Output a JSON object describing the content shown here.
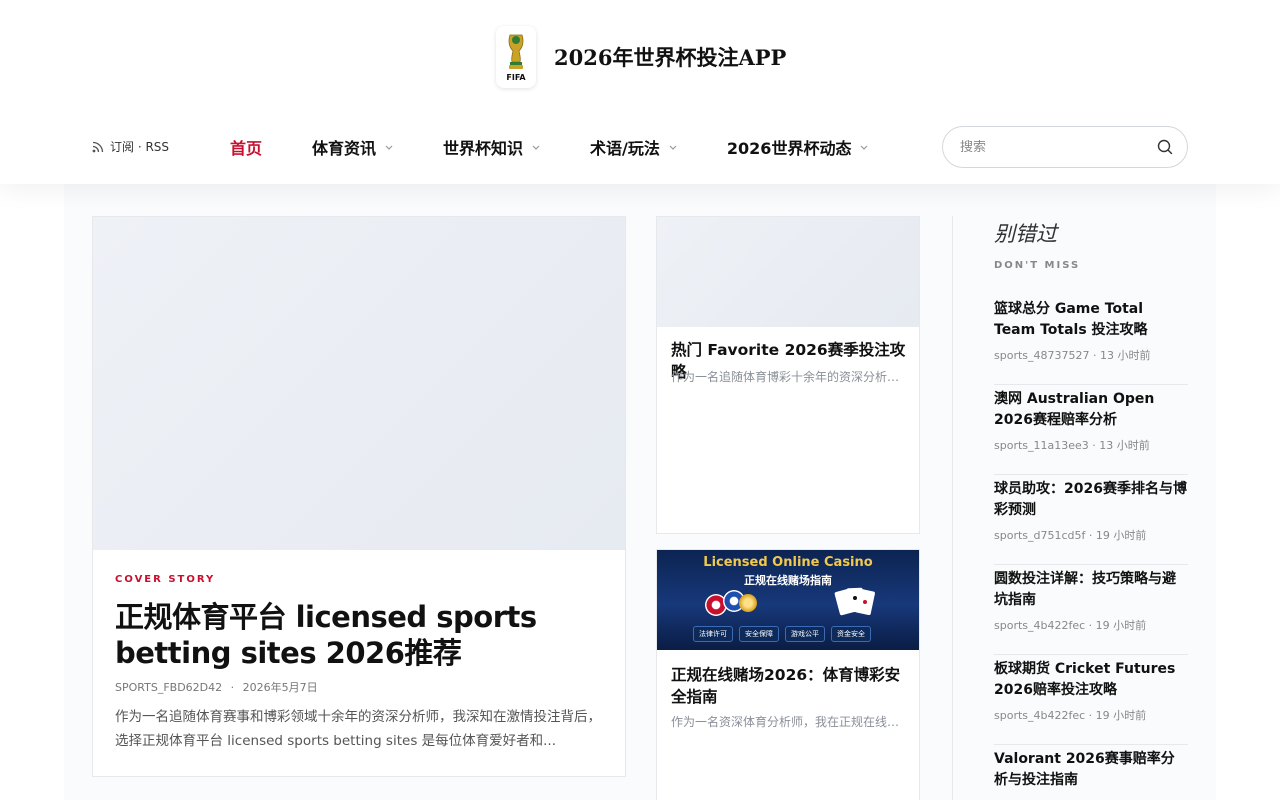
{
  "site": {
    "title": "2026年世界杯投注APP",
    "logo_label": "FIFA"
  },
  "header": {
    "rss_label": "订阅 · RSS",
    "nav": [
      {
        "label": "首页",
        "active": true,
        "has_dropdown": false
      },
      {
        "label": "体育资讯",
        "active": false,
        "has_dropdown": true
      },
      {
        "label": "世界杯知识",
        "active": false,
        "has_dropdown": true
      },
      {
        "label": "术语/玩法",
        "active": false,
        "has_dropdown": true
      },
      {
        "label": "2026世界杯动态",
        "active": false,
        "has_dropdown": true
      }
    ],
    "search_placeholder": "搜索"
  },
  "main_story": {
    "kicker": "COVER STORY",
    "title": "正规体育平台 licensed sports betting sites 2026推荐",
    "author": "SPORTS_FBD62D42",
    "date": "2026年5月7日",
    "meta_separator": "·",
    "excerpt": "作为一名追随体育赛事和博彩领域十余年的资深分析师，我深知在激情投注背后，选择正规体育平台 licensed sports betting sites 是每位体育爱好者和..."
  },
  "side_stories": [
    {
      "title": "热门 Favorite 2026赛季投注攻略",
      "excerpt": "作为一名追随体育博彩十余年的资深分析师..."
    },
    {
      "title": "正规在线赌场2026：体育博彩安全指南",
      "excerpt": "作为一名资深体育分析师，我在正规在线赌场...",
      "banner": {
        "title_en": "Licensed Online Casino",
        "title_cn": "正规在线赌场指南",
        "badges": [
          "法律许可",
          "安全保障",
          "游戏公平",
          "资金安全"
        ]
      }
    }
  ],
  "sidebar": {
    "heading": "别错过",
    "subheading": "DON'T MISS",
    "items": [
      {
        "title": "篮球总分 Game Total Team Totals 投注攻略",
        "meta": "sports_48737527 · 13 小时前"
      },
      {
        "title": "澳网 Australian Open 2026赛程赔率分析",
        "meta": "sports_11a13ee3 · 13 小时前"
      },
      {
        "title": "球员助攻：2026赛季排名与博彩预测",
        "meta": "sports_d751cd5f · 19 小时前"
      },
      {
        "title": "圆数投注详解：技巧策略与避坑指南",
        "meta": "sports_4b422fec · 19 小时前"
      },
      {
        "title": "板球期货 Cricket Futures 2026赔率投注攻略",
        "meta": "sports_4b422fec · 19 小时前"
      },
      {
        "title": "Valorant 2026赛事赔率分析与投注指南",
        "meta": ""
      }
    ]
  },
  "colors": {
    "accent": "#c8102e",
    "text": "#111111",
    "muted": "#888888",
    "border": "#e6e8ec"
  }
}
